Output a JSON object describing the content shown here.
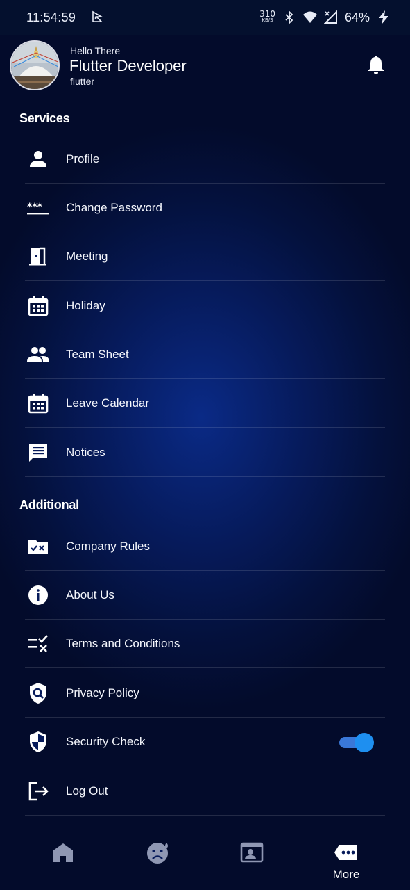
{
  "status_bar": {
    "time": "11:54:59",
    "net_speed_value": "310",
    "net_speed_unit": "KB/S",
    "battery": "64%"
  },
  "header": {
    "greeting": "Hello There",
    "name": "Flutter Developer",
    "handle": "flutter"
  },
  "sections": {
    "services": {
      "title": "Services",
      "items": [
        {
          "label": "Profile",
          "icon": "person-icon"
        },
        {
          "label": "Change Password",
          "icon": "password-icon"
        },
        {
          "label": "Meeting",
          "icon": "door-icon"
        },
        {
          "label": "Holiday",
          "icon": "calendar-icon"
        },
        {
          "label": "Team Sheet",
          "icon": "people-icon"
        },
        {
          "label": "Leave Calendar",
          "icon": "calendar-icon"
        },
        {
          "label": "Notices",
          "icon": "message-icon"
        }
      ]
    },
    "additional": {
      "title": "Additional",
      "items": [
        {
          "label": "Company Rules",
          "icon": "folder-rules-icon"
        },
        {
          "label": "About Us",
          "icon": "info-icon"
        },
        {
          "label": "Terms and Conditions",
          "icon": "rule-list-icon"
        },
        {
          "label": "Privacy Policy",
          "icon": "shield-search-icon"
        },
        {
          "label": "Security Check",
          "icon": "shield-icon",
          "toggle_on": true
        },
        {
          "label": "Log Out",
          "icon": "logout-icon"
        }
      ]
    }
  },
  "bottom_nav": {
    "items": [
      {
        "icon": "home-icon"
      },
      {
        "icon": "sad-face-icon"
      },
      {
        "icon": "contact-card-icon"
      },
      {
        "icon": "more-icon",
        "label": "More",
        "active": true
      }
    ]
  },
  "colors": {
    "background": "#04113d",
    "accent": "#1e8ff0",
    "inactive_nav": "#8f97b3"
  }
}
